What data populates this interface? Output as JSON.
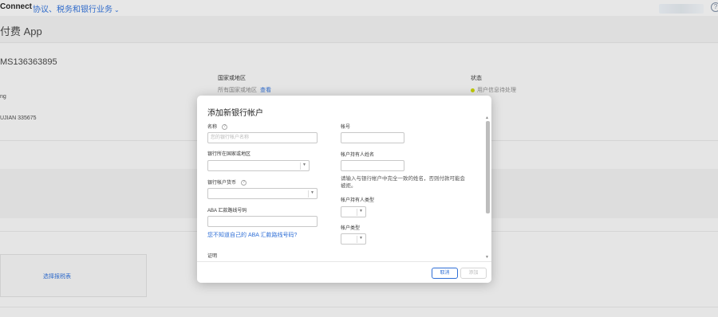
{
  "header": {
    "brand": "Connect",
    "menu_label": "协议、税务和银行业务",
    "menu_chevron": "⌄",
    "help_icon_glyph": "?"
  },
  "page": {
    "title": "付费 App",
    "account_id": "MS136363895",
    "country_heading": "国家或地区",
    "country_value": "所有国家或地区",
    "country_link": "查看",
    "status_heading": "状态",
    "status_value": "用户信息待处理",
    "status_color": "#c9d400",
    "address_line1": "ng",
    "address_line2": "UJIAN 335675",
    "upload_link": "选择报税表"
  },
  "modal": {
    "title": "添加新银行帐户",
    "name_label": "名称",
    "name_placeholder": "您的银行帐户名称",
    "bank_country_label": "银行所在国家或地区",
    "currency_label": "银行帐户货币",
    "aba_label": "ABA 汇款路线号码",
    "aba_help_link": "您不知道自己的 ABA 汇款路线号码?",
    "proof_label": "证明",
    "account_number_label": "帐号",
    "holder_name_label": "帐户持有人姓名",
    "holder_name_hint": "请输入与银行帐户中完全一致的姓名，否则付款可能会被拒。",
    "holder_type_label": "帐户持有人类型",
    "account_type_label": "帐户类型",
    "cancel_label": "取消",
    "add_label": "添加"
  }
}
